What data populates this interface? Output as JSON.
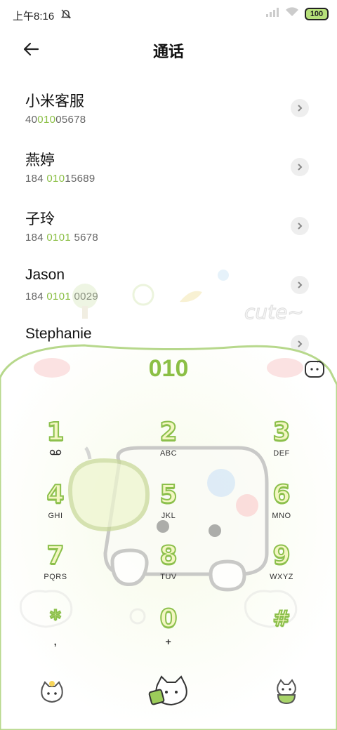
{
  "status_bar": {
    "time": "上午8:16",
    "battery": "100"
  },
  "header": {
    "title": "通话"
  },
  "contacts": [
    {
      "name": "小米客服",
      "num_pre": "40",
      "num_hl": "010",
      "num_post": "05678"
    },
    {
      "name": "燕婷",
      "num_pre": "184 ",
      "num_hl": "010",
      "num_post": "15689"
    },
    {
      "name": "子玲",
      "num_pre": "184 ",
      "num_hl": "0101",
      "num_post": " 5678"
    },
    {
      "name": "Jason",
      "num_pre": "184 ",
      "num_hl": "0101",
      "num_post": " 0029"
    },
    {
      "name": "Stephanie",
      "num_pre": "",
      "num_hl": "",
      "num_post": ""
    }
  ],
  "dialer": {
    "entered": "010",
    "keys": [
      {
        "digit": "1",
        "letters": "voicemail-icon"
      },
      {
        "digit": "2",
        "letters": "ABC"
      },
      {
        "digit": "3",
        "letters": "DEF"
      },
      {
        "digit": "4",
        "letters": "GHI"
      },
      {
        "digit": "5",
        "letters": "JKL"
      },
      {
        "digit": "6",
        "letters": "MNO"
      },
      {
        "digit": "7",
        "letters": "PQRS"
      },
      {
        "digit": "8",
        "letters": "TUV"
      },
      {
        "digit": "9",
        "letters": "WXYZ"
      },
      {
        "digit": "*",
        "letters": ","
      },
      {
        "digit": "0",
        "letters": "+"
      },
      {
        "digit": "#",
        "letters": ""
      }
    ]
  },
  "decor": {
    "cute_text": "cute~"
  },
  "colors": {
    "accent": "#8bbf45",
    "key_fill": "#f3f6c2"
  }
}
